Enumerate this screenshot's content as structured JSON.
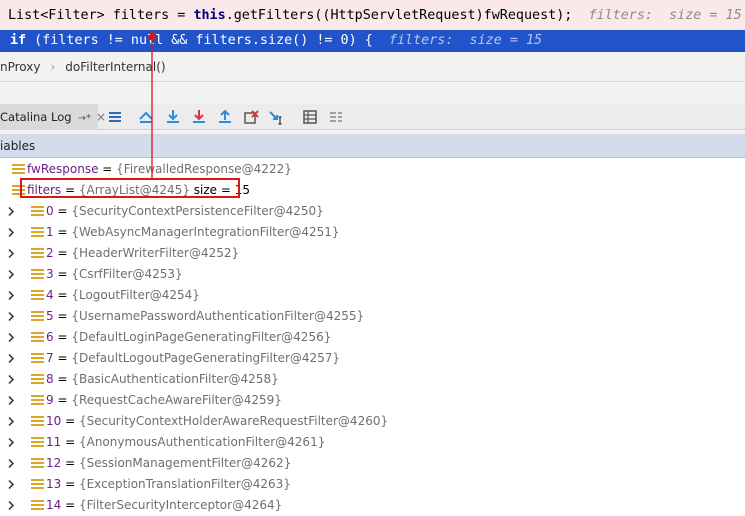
{
  "editor": {
    "line1": {
      "type_text": "List<Filter> filters = ",
      "kw": "this",
      "rest": ".getFilters((HttpServletRequest)fwRequest);",
      "hint": "filters:  size = 15"
    },
    "line2": {
      "kw": "if",
      "rest": " (filters != null && filters.size() != 0) {",
      "hint": "filters:  size = 15"
    }
  },
  "breadcrumb": {
    "item1": "nProxy",
    "item2": "doFilterInternal()",
    "sep": "›"
  },
  "toolbar": {
    "tab_label": "Catalina Log",
    "tab_pin": "→*",
    "tab_close": "×",
    "icons": [
      "menu-icon",
      "show-execution-point-icon",
      "step-over-icon",
      "step-into-icon",
      "step-out-icon",
      "drop-frame-icon",
      "run-to-cursor-icon",
      "evaluate-icon",
      "trace-icon"
    ]
  },
  "panel": {
    "title": "iables"
  },
  "variables": [
    {
      "name": "fwResponse",
      "eq": " = ",
      "value": "{FirewalledResponse@4222}",
      "expandable": false,
      "indent": 0
    },
    {
      "name": "filters",
      "eq": " = ",
      "value": "{ArrayList@4245}",
      "extra": "  size = 15",
      "expandable": false,
      "indent": 0
    },
    {
      "name": "0",
      "eq": " = ",
      "value": "{SecurityContextPersistenceFilter@4250}",
      "expandable": true,
      "indent": 1
    },
    {
      "name": "1",
      "eq": " = ",
      "value": "{WebAsyncManagerIntegrationFilter@4251}",
      "expandable": true,
      "indent": 1
    },
    {
      "name": "2",
      "eq": " = ",
      "value": "{HeaderWriterFilter@4252}",
      "expandable": true,
      "indent": 1
    },
    {
      "name": "3",
      "eq": " = ",
      "value": "{CsrfFilter@4253}",
      "expandable": true,
      "indent": 1
    },
    {
      "name": "4",
      "eq": " = ",
      "value": "{LogoutFilter@4254}",
      "expandable": true,
      "indent": 1
    },
    {
      "name": "5",
      "eq": " = ",
      "value": "{UsernamePasswordAuthenticationFilter@4255}",
      "expandable": true,
      "indent": 1
    },
    {
      "name": "6",
      "eq": " = ",
      "value": "{DefaultLoginPageGeneratingFilter@4256}",
      "expandable": true,
      "indent": 1
    },
    {
      "name": "7",
      "eq": " = ",
      "value": "{DefaultLogoutPageGeneratingFilter@4257}",
      "expandable": true,
      "indent": 1
    },
    {
      "name": "8",
      "eq": " = ",
      "value": "{BasicAuthenticationFilter@4258}",
      "expandable": true,
      "indent": 1
    },
    {
      "name": "9",
      "eq": " = ",
      "value": "{RequestCacheAwareFilter@4259}",
      "expandable": true,
      "indent": 1
    },
    {
      "name": "10",
      "eq": " = ",
      "value": "{SecurityContextHolderAwareRequestFilter@4260}",
      "expandable": true,
      "indent": 1
    },
    {
      "name": "11",
      "eq": " = ",
      "value": "{AnonymousAuthenticationFilter@4261}",
      "expandable": true,
      "indent": 1
    },
    {
      "name": "12",
      "eq": " = ",
      "value": "{SessionManagementFilter@4262}",
      "expandable": true,
      "indent": 1
    },
    {
      "name": "13",
      "eq": " = ",
      "value": "{ExceptionTranslationFilter@4263}",
      "expandable": true,
      "indent": 1
    },
    {
      "name": "14",
      "eq": " = ",
      "value": "{FilterSecurityInterceptor@4264}",
      "expandable": true,
      "indent": 1
    }
  ],
  "colors": {
    "highlight_box": "#d81818",
    "current_line": "#2154ca",
    "breakpoint_line": "#fbe8e8",
    "field_icon": "#d9a826"
  }
}
